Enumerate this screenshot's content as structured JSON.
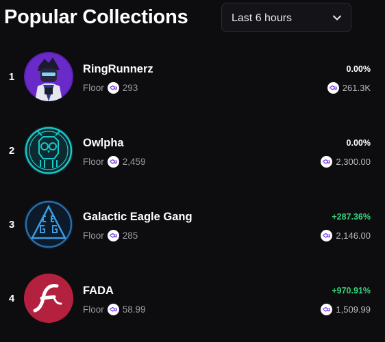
{
  "header": {
    "title": "Popular Collections",
    "timeframe": {
      "selected": "Last 6 hours"
    }
  },
  "collections": [
    {
      "rank": "1",
      "name": "RingRunnerz",
      "floor_label": "Floor",
      "floor_price": "293",
      "change": "0.00%",
      "volume": "261.3K",
      "change_color": "#ffffff"
    },
    {
      "rank": "2",
      "name": "Owlpha",
      "floor_label": "Floor",
      "floor_price": "2,459",
      "change": "0.00%",
      "volume": "2,300.00",
      "change_color": "#ffffff"
    },
    {
      "rank": "3",
      "name": "Galactic Eagle Gang",
      "floor_label": "Floor",
      "floor_price": "285",
      "change": "+287.36%",
      "volume": "2,146.00",
      "change_color": "#34d07a"
    },
    {
      "rank": "4",
      "name": "FADA",
      "floor_label": "Floor",
      "floor_price": "58.99",
      "change": "+970.91%",
      "volume": "1,509.99",
      "change_color": "#34d07a"
    }
  ],
  "icons": {
    "currency": "polygon-matic-icon",
    "dropdown": "chevron-down-icon"
  },
  "colors": {
    "background": "#0d0d0f",
    "positive": "#34d07a",
    "coin": "#8247e5",
    "muted": "#9b9ba3"
  }
}
